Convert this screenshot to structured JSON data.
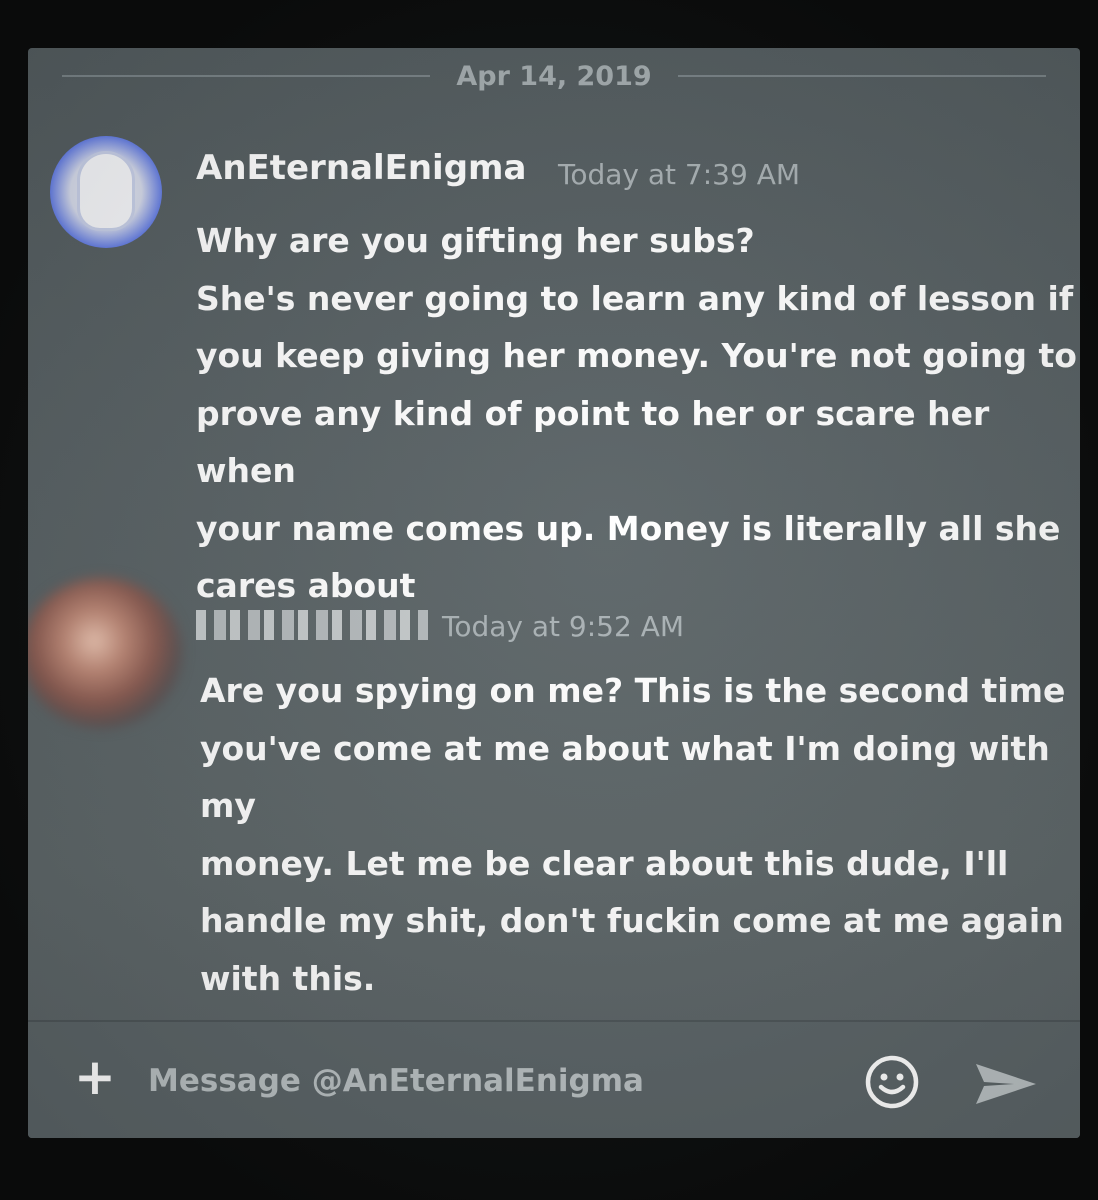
{
  "divider": {
    "date": "Apr 14, 2019"
  },
  "messages": [
    {
      "author": "AnEternalEnigma",
      "timestamp": "Today at 7:39 AM",
      "text": "Why are you gifting her subs?\nShe's never going to learn any kind of lesson if\nyou keep giving her money. You're not going to\nprove any kind of point to her or scare her when\nyour name comes up. Money is literally all she\ncares about"
    },
    {
      "author_redacted": true,
      "timestamp": "Today at 9:52 AM",
      "text": "Are you spying on me? This is the second time\nyou've come at me about what I'm doing with my\nmoney. Let me be clear about this dude, I'll\nhandle my shit, don't fuckin come at me again\nwith this."
    }
  ],
  "composer": {
    "placeholder": "Message @AnEternalEnigma",
    "add_icon": "plus-icon",
    "emoji_icon": "smiley-icon",
    "send_icon": "send-arrow-icon"
  },
  "colors": {
    "background": "#5b6366",
    "text": "#ffffff",
    "muted": "#aab2b5"
  }
}
